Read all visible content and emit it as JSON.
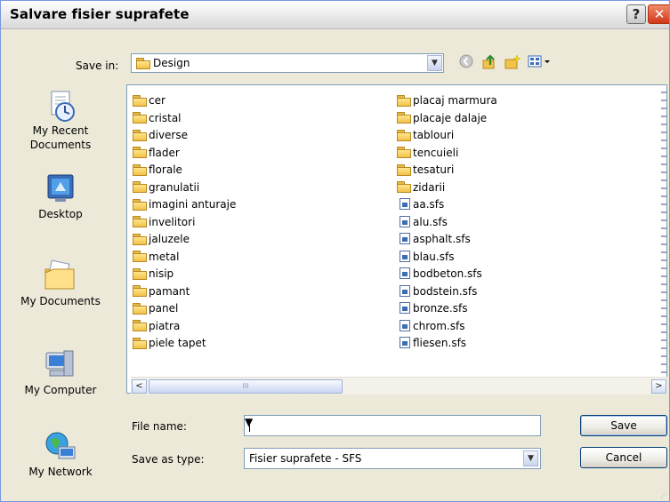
{
  "window": {
    "title": "Salvare fisier suprafete"
  },
  "titlebar": {
    "help": "?",
    "close": "✕"
  },
  "save_in": {
    "label": "Save in:",
    "value": "Design"
  },
  "places": [
    {
      "name": "my-recent-documents",
      "label_line1": "My Recent",
      "label_line2": "Documents"
    },
    {
      "name": "desktop",
      "label_line1": "Desktop",
      "label_line2": ""
    },
    {
      "name": "my-documents",
      "label_line1": "My Documents",
      "label_line2": ""
    },
    {
      "name": "my-computer",
      "label_line1": "My Computer",
      "label_line2": ""
    },
    {
      "name": "my-network",
      "label_line1": "My Network",
      "label_line2": ""
    }
  ],
  "files": {
    "column1": [
      "cer",
      "cristal",
      "diverse",
      "flader",
      "florale",
      "granulatii",
      "imagini anturaje",
      "invelitori",
      "jaluzele",
      "metal",
      "nisip",
      "pamant",
      "panel",
      "piatra",
      "piele tapet"
    ],
    "column2_folders": [
      "placaj marmura",
      "placaje dalaje",
      "tablouri",
      "tencuieli",
      "tesaturi",
      "zidarii"
    ],
    "column2_files": [
      "aa.sfs",
      "alu.sfs",
      "asphalt.sfs",
      "blau.sfs",
      "bodbeton.sfs",
      "bodstein.sfs",
      "bronze.sfs",
      "chrom.sfs",
      "fliesen.sfs"
    ]
  },
  "file_name": {
    "label": "File name:",
    "value": ""
  },
  "save_as_type": {
    "label": "Save as type:",
    "value": "Fisier suprafete - SFS"
  },
  "buttons": {
    "save": "Save",
    "cancel": "Cancel"
  },
  "scrollbar": {
    "left": "<",
    "right": ">",
    "grip": "III"
  },
  "icons": [
    "back-icon",
    "up-folder-icon",
    "new-folder-icon",
    "views-menu-icon"
  ]
}
